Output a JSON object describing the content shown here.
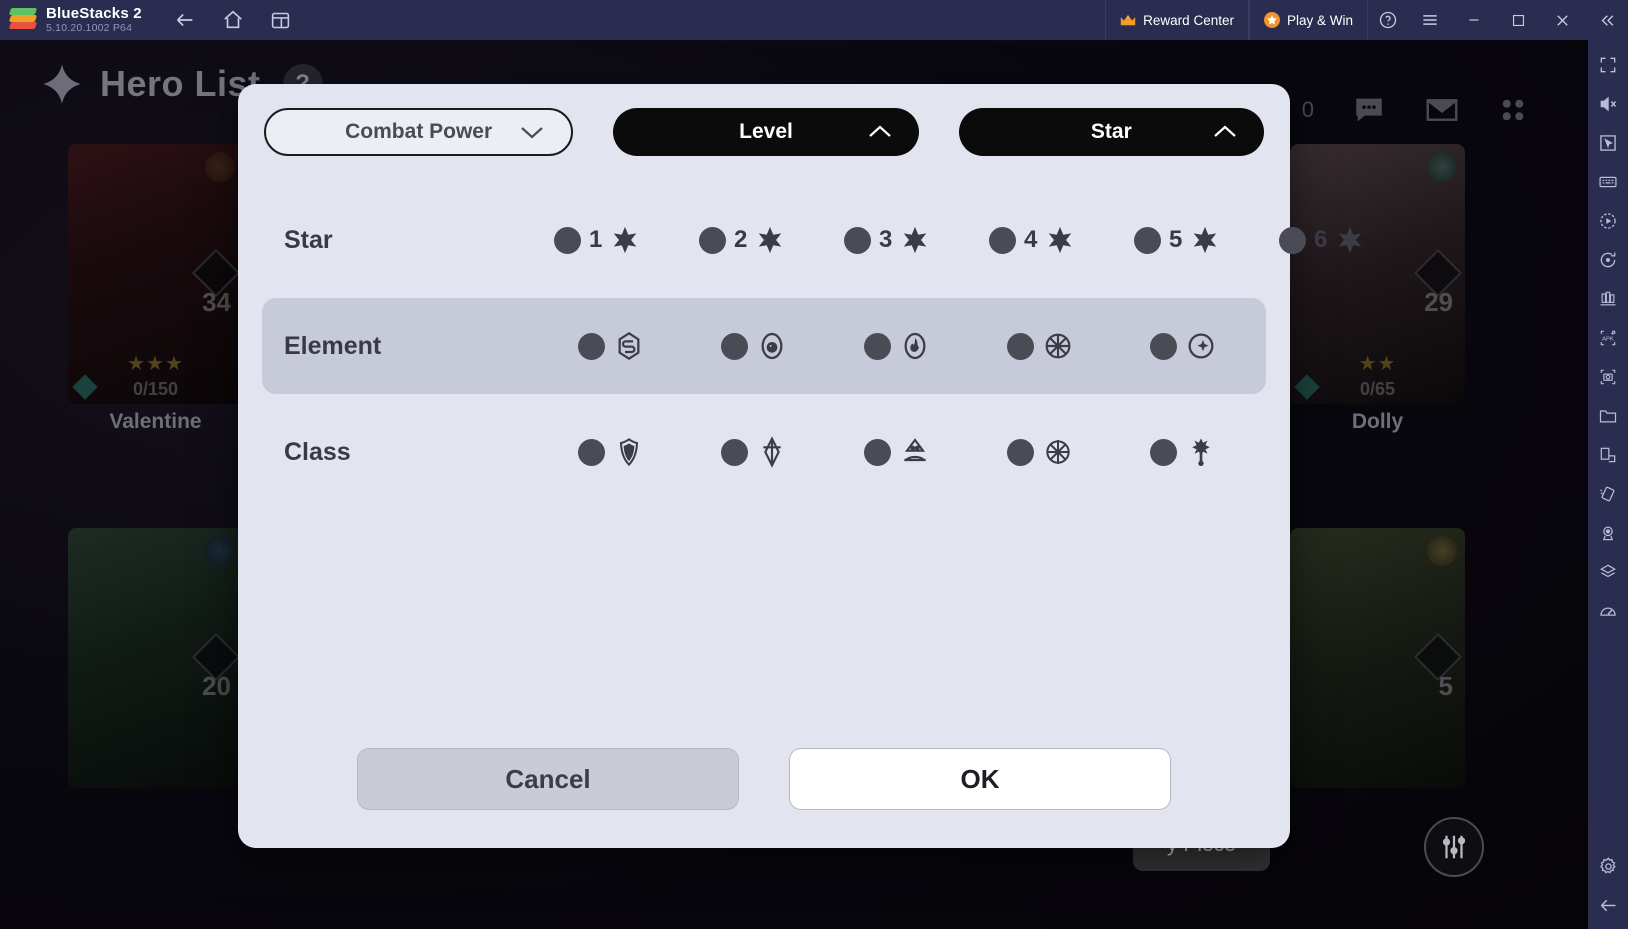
{
  "titlebar": {
    "app_name": "BlueStacks 2",
    "version": "5.10.20.1002  P64",
    "nav": [
      {
        "name": "back-icon",
        "label": "Back"
      },
      {
        "name": "home-icon",
        "label": "Home"
      },
      {
        "name": "multi-instance-icon",
        "label": "Instance Manager"
      }
    ],
    "reward_center": "Reward Center",
    "play_and_win": "Play & Win",
    "window_controls": [
      "help-icon",
      "menu-icon",
      "minimize-icon",
      "maximize-icon",
      "close-icon",
      "collapse-icon"
    ]
  },
  "sidebar": {
    "items": [
      {
        "name": "fullscreen-icon",
        "label": "Full screen"
      },
      {
        "name": "mute-icon",
        "label": "Mute"
      },
      {
        "name": "cursor-icon",
        "label": "Game controls"
      },
      {
        "name": "keyboard-icon",
        "label": "Keymapping"
      },
      {
        "name": "macro-play-icon",
        "label": "Macro recorder"
      },
      {
        "name": "rotate-icon",
        "label": "Rotate"
      },
      {
        "name": "multi-instance-sync-icon",
        "label": "Multi-instance sync"
      },
      {
        "name": "install-apk-icon",
        "label": "Install APK"
      },
      {
        "name": "screenshot-icon",
        "label": "Screenshot"
      },
      {
        "name": "media-folder-icon",
        "label": "Media manager"
      },
      {
        "name": "copy-to-pc-icon",
        "label": "Copy to PC"
      },
      {
        "name": "shake-icon",
        "label": "Shake"
      },
      {
        "name": "location-icon",
        "label": "Location"
      },
      {
        "name": "layers-icon",
        "label": "Layers"
      },
      {
        "name": "performance-icon",
        "label": "Performance"
      },
      {
        "name": "settings-icon",
        "label": "Settings"
      },
      {
        "name": "back-arrow-icon",
        "label": "Back"
      }
    ]
  },
  "game": {
    "page_title": "Hero List",
    "help_badge": "?",
    "top_right": {
      "currency_value": "0",
      "icons": [
        "flower-icon",
        "chat-icon",
        "mail-icon",
        "grid-menu-icon"
      ]
    },
    "heroes": [
      {
        "name": "Valentine",
        "level": "34",
        "progress": "0/150",
        "stars": "★★★",
        "art": "art1"
      },
      {
        "name": "",
        "level": "20",
        "progress": "",
        "stars": "",
        "art": "art2"
      },
      {
        "name": "Dolly",
        "level": "29",
        "progress": "0/65",
        "stars": "★★",
        "art": "art3"
      },
      {
        "name": "",
        "level": "5",
        "progress": "",
        "stars": "",
        "art": "art4"
      }
    ],
    "bottom_pill": "y Piece",
    "sliders_icon": "filter-sliders-icon"
  },
  "dialog": {
    "sort_buttons": [
      {
        "label": "Combat Power",
        "state": "off",
        "chevron": "chevron-down-icon"
      },
      {
        "label": "Level",
        "state": "on",
        "chevron": "chevron-up-icon"
      },
      {
        "label": "Star",
        "state": "on",
        "chevron": "chevron-up-icon"
      }
    ],
    "filters": [
      {
        "label": "Star",
        "highlight": false,
        "options": [
          {
            "num": "1",
            "icon": "star-icon"
          },
          {
            "num": "2",
            "icon": "star-icon"
          },
          {
            "num": "3",
            "icon": "star-icon"
          },
          {
            "num": "4",
            "icon": "star-icon"
          },
          {
            "num": "5",
            "icon": "star-icon"
          },
          {
            "num": "6",
            "icon": "star-icon"
          }
        ]
      },
      {
        "label": "Element",
        "highlight": true,
        "options": [
          {
            "num": "",
            "icon": "element-earth-icon"
          },
          {
            "num": "",
            "icon": "element-water-icon"
          },
          {
            "num": "",
            "icon": "element-fire-icon"
          },
          {
            "num": "",
            "icon": "element-light-icon"
          },
          {
            "num": "",
            "icon": "element-dark-icon"
          }
        ]
      },
      {
        "label": "Class",
        "highlight": false,
        "options": [
          {
            "num": "",
            "icon": "class-defender-icon"
          },
          {
            "num": "",
            "icon": "class-warrior-icon"
          },
          {
            "num": "",
            "icon": "class-ranger-icon"
          },
          {
            "num": "",
            "icon": "class-mage-icon"
          },
          {
            "num": "",
            "icon": "class-support-icon"
          }
        ]
      }
    ],
    "cancel_label": "Cancel",
    "ok_label": "OK"
  },
  "colors": {
    "titlebar_bg": "#2a2d4f",
    "dialog_bg": "#e2e4ef",
    "highlight_row": "#c7cad8",
    "selected_sort": "#0b0b0b",
    "accent_orange": "#f0932b"
  }
}
